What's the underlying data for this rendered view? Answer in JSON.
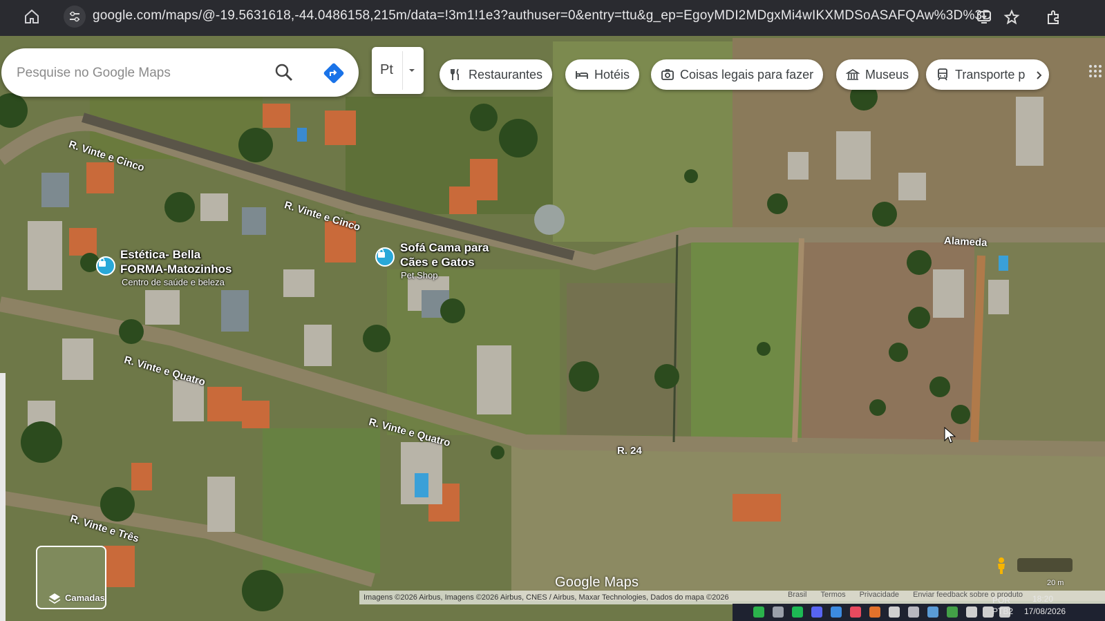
{
  "browser": {
    "url": "google.com/maps/@-19.5631618,-44.0486158,215m/data=!3m1!1e3?authuser=0&entry=ttu&g_ep=EgoyMDI2MDgxMi4wIKXMDSoASAFQAw%3D%3D",
    "icons": [
      "home-icon",
      "site-settings-icon",
      "install-app-icon",
      "star-icon",
      "extensions-icon"
    ]
  },
  "search": {
    "placeholder": "Pesquise no Google Maps",
    "profile_label": "Pt"
  },
  "chips": [
    {
      "label": "Restaurantes",
      "icon": "fork-knife-icon"
    },
    {
      "label": "Hotéis",
      "icon": "bed-icon"
    },
    {
      "label": "Coisas legais para fazer",
      "icon": "camera-icon"
    },
    {
      "label": "Museus",
      "icon": "museum-icon"
    },
    {
      "label": "Transporte p",
      "icon": "transit-icon"
    }
  ],
  "streets": [
    "R. Vinte e Cinco",
    "R. Vinte e Cinco",
    "R. Vinte e Quatro",
    "R. Vinte e Quatro",
    "R. Vinte e Três",
    "R. 24",
    "Alameda"
  ],
  "places": [
    {
      "name_line1": "Estética- Bella",
      "name_line2": "FORMA-Matozinhos",
      "category": "Centro de saúde e beleza"
    },
    {
      "name_line1": "Sofá Cama para",
      "name_line2": "Cães e Gatos",
      "category": "Pet Shop"
    }
  ],
  "layers_label": "Camadas",
  "logo": "Google Maps",
  "attribution": "Imagens ©2026 Airbus, Imagens ©2026 Airbus, CNES / Airbus, Maxar Technologies, Dados do mapa ©2026",
  "footer_links": [
    "Brasil",
    "Termos",
    "Privacidade",
    "Enviar feedback sobre o produto"
  ],
  "scale": "20 m",
  "system": {
    "lang": "POR",
    "layout": "PTB2",
    "time": "18:20",
    "date": "17/08/2026"
  },
  "colors": {
    "chrome": "#2a2b30",
    "poi_pin": "#29a8d8",
    "directions": "#1a73e8"
  }
}
